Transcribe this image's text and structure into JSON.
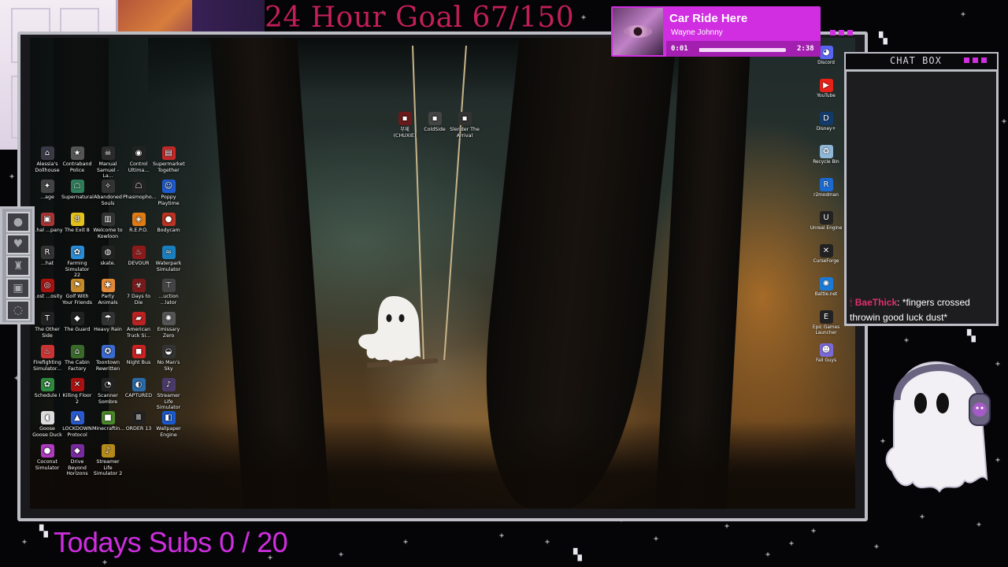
{
  "overlay": {
    "goal_title": "24 Hour Goal 67/150",
    "subs_text": "Todays Subs 0 / 20",
    "chat_title": "CHAT BOX"
  },
  "music": {
    "title": "Car Ride Here",
    "artist": "Wayne Johnny",
    "elapsed": "0:01",
    "duration": "2:38",
    "progress": 0.006
  },
  "chat": {
    "messages": [
      {
        "user": "BaeThick",
        "text": ": *fingers crossed throwin good luck dust*"
      }
    ]
  },
  "desktop_icons": [
    {
      "label": "Alessia's Dollhouse",
      "icon": "house-icon",
      "color": "#3a3a46"
    },
    {
      "label": "Contraband Police",
      "icon": "police-icon",
      "color": "#555"
    },
    {
      "label": "Manual Samuel - La...",
      "icon": "skull-icon",
      "color": "#2b2b2b"
    },
    {
      "label": "Control Ultima...",
      "icon": "eye-icon",
      "color": "#222"
    },
    {
      "label": "Supermarket Together",
      "icon": "cart-icon",
      "color": "#c62828"
    },
    {
      "label": "...age",
      "icon": "wrench-icon",
      "color": "#444"
    },
    {
      "label": "Supernatural",
      "icon": "ghost-icon",
      "color": "#2e7d5a"
    },
    {
      "label": "Abandoned Souls",
      "icon": "soul-icon",
      "color": "#333"
    },
    {
      "label": "Phasmopho...",
      "icon": "ghost-icon",
      "color": "#222"
    },
    {
      "label": "Poppy Playtime",
      "icon": "toy-icon",
      "color": "#1e5bd1"
    },
    {
      "label": "...hal ...pany",
      "icon": "box-icon",
      "color": "#a33"
    },
    {
      "label": "The Exit 8",
      "icon": "sign-icon",
      "color": "#e4c21c"
    },
    {
      "label": "Welcome to Kowloon",
      "icon": "city-icon",
      "color": "#333"
    },
    {
      "label": "R.E.P.O.",
      "icon": "robot-icon",
      "color": "#e07b14"
    },
    {
      "label": "Bodycam",
      "icon": "camera-icon",
      "color": "#b32"
    },
    {
      "label": "...hat",
      "icon": "r-icon",
      "color": "#333"
    },
    {
      "label": "Farming Simulator 22",
      "icon": "tractor-icon",
      "color": "#2a8bd6"
    },
    {
      "label": "skate.",
      "icon": "skate-icon",
      "color": "#222"
    },
    {
      "label": "DEVOUR",
      "icon": "flame-icon",
      "color": "#8c1a1a"
    },
    {
      "label": "Waterpark Simulator",
      "icon": "wave-icon",
      "color": "#1a7fbf"
    },
    {
      "label": "...ost ...osity",
      "icon": "bubble-icon",
      "color": "#a11"
    },
    {
      "label": "Golf With Your Friends",
      "icon": "golf-icon",
      "color": "#c78a2a"
    },
    {
      "label": "Party Animals",
      "icon": "paw-icon",
      "color": "#e28a3a"
    },
    {
      "label": "7 Days to Die",
      "icon": "zombie-icon",
      "color": "#7a1a1a"
    },
    {
      "label": "...uction ...lator",
      "icon": "crane-icon",
      "color": "#444"
    },
    {
      "label": "The Other Side",
      "icon": "tos-icon",
      "color": "#222"
    },
    {
      "label": "The Guard",
      "icon": "guard-icon",
      "color": "#222"
    },
    {
      "label": "Heavy Rain",
      "icon": "rain-icon",
      "color": "#333"
    },
    {
      "label": "American Truck Si...",
      "icon": "truck-icon",
      "color": "#b22"
    },
    {
      "label": "Emissary Zero",
      "icon": "gear-icon",
      "color": "#555"
    },
    {
      "label": "Firefighting Simulator...",
      "icon": "fire-icon",
      "color": "#c33"
    },
    {
      "label": "The Cabin Factory",
      "icon": "cabin-icon",
      "color": "#3a6a2a"
    },
    {
      "label": "Toontown Rewritten",
      "icon": "toon-icon",
      "color": "#3a6ad0"
    },
    {
      "label": "Night Bus",
      "icon": "bus-icon",
      "color": "#c22"
    },
    {
      "label": "No Man's Sky",
      "icon": "planet-icon",
      "color": "#333"
    },
    {
      "label": "Schedule I",
      "icon": "leaf-icon",
      "color": "#2e8b3e"
    },
    {
      "label": "Killing Floor 2",
      "icon": "blade-icon",
      "color": "#a11"
    },
    {
      "label": "Scanner Sombre",
      "icon": "scan-icon",
      "color": "#222"
    },
    {
      "label": "CAPTURED",
      "icon": "capture-icon",
      "color": "#2a6aa8"
    },
    {
      "label": "Streamer Life Simulator",
      "icon": "stream-icon",
      "color": "#4a3a6a"
    },
    {
      "label": "Goose Goose Duck",
      "icon": "goose-icon",
      "color": "#ddd"
    },
    {
      "label": "LOCKDOWN Protocol",
      "icon": "lock-icon",
      "color": "#2a5ad0"
    },
    {
      "label": "Minecraftin...",
      "icon": "cube-icon",
      "color": "#4a8a2a"
    },
    {
      "label": "ORDER 13",
      "icon": "order-icon",
      "color": "#222"
    },
    {
      "label": "Wallpaper Engine",
      "icon": "wallpaper-icon",
      "color": "#1a5ad0"
    },
    {
      "label": "Coconut Simulator",
      "icon": "coconut-icon",
      "color": "#b03ac0"
    },
    {
      "label": "Drive Beyond Horizons",
      "icon": "car-icon",
      "color": "#7a2aa0"
    },
    {
      "label": "Streamer Life Simulator 2",
      "icon": "stream-icon",
      "color": "#b58a1a"
    }
  ],
  "center_icons": [
    {
      "label": "무제 (CHUXIE)",
      "icon": "red-file-icon",
      "color": "#6a1a1a"
    },
    {
      "label": "ColdSide",
      "icon": "cold-icon",
      "color": "#444"
    },
    {
      "label": "Slender The Arrival",
      "icon": "slender-icon",
      "color": "#333"
    }
  ],
  "right_icons": [
    {
      "label": "Discord",
      "icon": "discord-icon",
      "color": "#5865f2"
    },
    {
      "label": "YouTube",
      "icon": "youtube-icon",
      "color": "#e62117"
    },
    {
      "label": "Disney+",
      "icon": "disney-icon",
      "color": "#123a6a"
    },
    {
      "label": "Recycle Bin",
      "icon": "recycle-icon",
      "color": "#8fb7d8"
    },
    {
      "label": "r2modman",
      "icon": "r2-icon",
      "color": "#1a6ad0"
    },
    {
      "label": "Unreal Engine",
      "icon": "unreal-icon",
      "color": "#222"
    },
    {
      "label": "CurseForge",
      "icon": "curse-icon",
      "color": "#222"
    },
    {
      "label": "Battle.net",
      "icon": "battlenet-icon",
      "color": "#1a7ad8"
    },
    {
      "label": "Epic Games Launcher",
      "icon": "epic-icon",
      "color": "#222"
    },
    {
      "label": "Fall Guys",
      "icon": "fallguys-icon",
      "color": "#7a6ad8"
    }
  ],
  "colors": {
    "goal": "#c21f58",
    "accent": "#d02ee0",
    "frame": "#bdbdc6",
    "chat_user": "#e0306a"
  }
}
